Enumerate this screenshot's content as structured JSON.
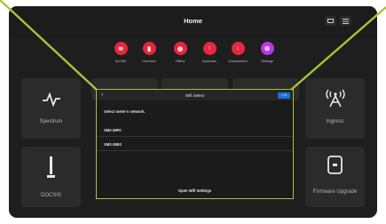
{
  "header": {
    "title": "Home",
    "grid_view_icon": "grid-view-icon",
    "list_view_icon": "list-view-icon"
  },
  "status": [
    {
      "label": "No Wifi",
      "icon": "wifi-off-icon",
      "glyph": "≋"
    },
    {
      "label": "Unknown",
      "icon": "unknown-icon",
      "glyph": "▮"
    },
    {
      "label": "Offline",
      "icon": "globe-icon",
      "glyph": "◍"
    },
    {
      "label": "Upstream",
      "icon": "upstream-icon",
      "glyph": "↑"
    },
    {
      "label": "Downstream",
      "icon": "downstream-icon",
      "glyph": "↓"
    },
    {
      "label": "Settings",
      "icon": "settings-icon",
      "glyph": "⚙"
    }
  ],
  "tiles": {
    "spectrum": {
      "label": "Spectrum",
      "icon": "spectrum-icon"
    },
    "ingress": {
      "label": "Ingress",
      "icon": "ingress-icon"
    },
    "docsis": {
      "label": "DOCSIS",
      "icon": "docsis-icon"
    },
    "firmware": {
      "label": "Firmware Upgrade",
      "icon": "firmware-upgrade-icon"
    }
  },
  "modal": {
    "title": "Wifi Select",
    "back_icon": "back-chevron-icon",
    "back_glyph": "‹",
    "button_label": "◁ ⊙",
    "prompt": "Select meter's network.",
    "networks": [
      "XM2-39F0",
      "XM2-39E0"
    ],
    "open_settings": "Open Wifi Settings"
  },
  "colors": {
    "status_red": "#e62640",
    "settings_purple": "#b43ae6",
    "highlight": "#a8c43a",
    "button_blue": "#1c6fd8"
  }
}
